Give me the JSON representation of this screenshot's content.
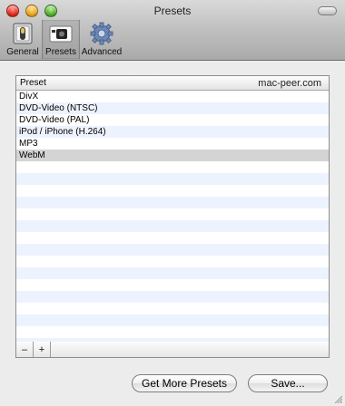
{
  "window": {
    "title": "Presets"
  },
  "toolbar": {
    "items": [
      {
        "label": "General",
        "icon": "general-switch-icon",
        "selected": false
      },
      {
        "label": "Presets",
        "icon": "presets-film-icon",
        "selected": true
      },
      {
        "label": "Advanced",
        "icon": "advanced-gear-icon",
        "selected": false
      }
    ]
  },
  "table": {
    "column_header": "Preset",
    "watermark": "mac-peer.com",
    "rows": [
      {
        "label": "DivX",
        "selected": false
      },
      {
        "label": "DVD-Video (NTSC)",
        "selected": false
      },
      {
        "label": "DVD-Video (PAL)",
        "selected": false
      },
      {
        "label": "iPod / iPhone (H.264)",
        "selected": false
      },
      {
        "label": "MP3",
        "selected": false
      },
      {
        "label": "WebM",
        "selected": true
      }
    ]
  },
  "controls": {
    "remove_label": "–",
    "add_label": "+"
  },
  "buttons": {
    "get_more_label": "Get More Presets",
    "save_label": "Save..."
  },
  "colors": {
    "row_stripe": "#edf3fe",
    "selected_row": "#d4d4d4",
    "window_bg": "#ececec"
  }
}
